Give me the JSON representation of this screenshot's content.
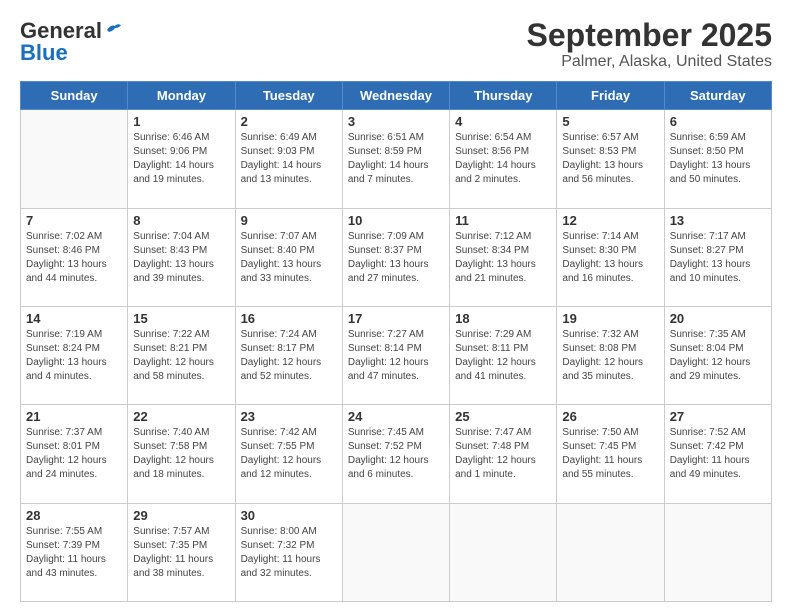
{
  "logo": {
    "general": "General",
    "blue": "Blue"
  },
  "title": "September 2025",
  "subtitle": "Palmer, Alaska, United States",
  "days_of_week": [
    "Sunday",
    "Monday",
    "Tuesday",
    "Wednesday",
    "Thursday",
    "Friday",
    "Saturday"
  ],
  "weeks": [
    [
      {
        "day": "",
        "info": ""
      },
      {
        "day": "1",
        "info": "Sunrise: 6:46 AM\nSunset: 9:06 PM\nDaylight: 14 hours\nand 19 minutes."
      },
      {
        "day": "2",
        "info": "Sunrise: 6:49 AM\nSunset: 9:03 PM\nDaylight: 14 hours\nand 13 minutes."
      },
      {
        "day": "3",
        "info": "Sunrise: 6:51 AM\nSunset: 8:59 PM\nDaylight: 14 hours\nand 7 minutes."
      },
      {
        "day": "4",
        "info": "Sunrise: 6:54 AM\nSunset: 8:56 PM\nDaylight: 14 hours\nand 2 minutes."
      },
      {
        "day": "5",
        "info": "Sunrise: 6:57 AM\nSunset: 8:53 PM\nDaylight: 13 hours\nand 56 minutes."
      },
      {
        "day": "6",
        "info": "Sunrise: 6:59 AM\nSunset: 8:50 PM\nDaylight: 13 hours\nand 50 minutes."
      }
    ],
    [
      {
        "day": "7",
        "info": "Sunrise: 7:02 AM\nSunset: 8:46 PM\nDaylight: 13 hours\nand 44 minutes."
      },
      {
        "day": "8",
        "info": "Sunrise: 7:04 AM\nSunset: 8:43 PM\nDaylight: 13 hours\nand 39 minutes."
      },
      {
        "day": "9",
        "info": "Sunrise: 7:07 AM\nSunset: 8:40 PM\nDaylight: 13 hours\nand 33 minutes."
      },
      {
        "day": "10",
        "info": "Sunrise: 7:09 AM\nSunset: 8:37 PM\nDaylight: 13 hours\nand 27 minutes."
      },
      {
        "day": "11",
        "info": "Sunrise: 7:12 AM\nSunset: 8:34 PM\nDaylight: 13 hours\nand 21 minutes."
      },
      {
        "day": "12",
        "info": "Sunrise: 7:14 AM\nSunset: 8:30 PM\nDaylight: 13 hours\nand 16 minutes."
      },
      {
        "day": "13",
        "info": "Sunrise: 7:17 AM\nSunset: 8:27 PM\nDaylight: 13 hours\nand 10 minutes."
      }
    ],
    [
      {
        "day": "14",
        "info": "Sunrise: 7:19 AM\nSunset: 8:24 PM\nDaylight: 13 hours\nand 4 minutes."
      },
      {
        "day": "15",
        "info": "Sunrise: 7:22 AM\nSunset: 8:21 PM\nDaylight: 12 hours\nand 58 minutes."
      },
      {
        "day": "16",
        "info": "Sunrise: 7:24 AM\nSunset: 8:17 PM\nDaylight: 12 hours\nand 52 minutes."
      },
      {
        "day": "17",
        "info": "Sunrise: 7:27 AM\nSunset: 8:14 PM\nDaylight: 12 hours\nand 47 minutes."
      },
      {
        "day": "18",
        "info": "Sunrise: 7:29 AM\nSunset: 8:11 PM\nDaylight: 12 hours\nand 41 minutes."
      },
      {
        "day": "19",
        "info": "Sunrise: 7:32 AM\nSunset: 8:08 PM\nDaylight: 12 hours\nand 35 minutes."
      },
      {
        "day": "20",
        "info": "Sunrise: 7:35 AM\nSunset: 8:04 PM\nDaylight: 12 hours\nand 29 minutes."
      }
    ],
    [
      {
        "day": "21",
        "info": "Sunrise: 7:37 AM\nSunset: 8:01 PM\nDaylight: 12 hours\nand 24 minutes."
      },
      {
        "day": "22",
        "info": "Sunrise: 7:40 AM\nSunset: 7:58 PM\nDaylight: 12 hours\nand 18 minutes."
      },
      {
        "day": "23",
        "info": "Sunrise: 7:42 AM\nSunset: 7:55 PM\nDaylight: 12 hours\nand 12 minutes."
      },
      {
        "day": "24",
        "info": "Sunrise: 7:45 AM\nSunset: 7:52 PM\nDaylight: 12 hours\nand 6 minutes."
      },
      {
        "day": "25",
        "info": "Sunrise: 7:47 AM\nSunset: 7:48 PM\nDaylight: 12 hours\nand 1 minute."
      },
      {
        "day": "26",
        "info": "Sunrise: 7:50 AM\nSunset: 7:45 PM\nDaylight: 11 hours\nand 55 minutes."
      },
      {
        "day": "27",
        "info": "Sunrise: 7:52 AM\nSunset: 7:42 PM\nDaylight: 11 hours\nand 49 minutes."
      }
    ],
    [
      {
        "day": "28",
        "info": "Sunrise: 7:55 AM\nSunset: 7:39 PM\nDaylight: 11 hours\nand 43 minutes."
      },
      {
        "day": "29",
        "info": "Sunrise: 7:57 AM\nSunset: 7:35 PM\nDaylight: 11 hours\nand 38 minutes."
      },
      {
        "day": "30",
        "info": "Sunrise: 8:00 AM\nSunset: 7:32 PM\nDaylight: 11 hours\nand 32 minutes."
      },
      {
        "day": "",
        "info": ""
      },
      {
        "day": "",
        "info": ""
      },
      {
        "day": "",
        "info": ""
      },
      {
        "day": "",
        "info": ""
      }
    ]
  ]
}
